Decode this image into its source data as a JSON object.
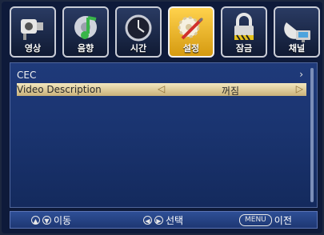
{
  "tabs": [
    {
      "label": "영상",
      "icon": "camera-icon",
      "selected": false
    },
    {
      "label": "음향",
      "icon": "music-note-icon",
      "selected": false
    },
    {
      "label": "시간",
      "icon": "clock-icon",
      "selected": false
    },
    {
      "label": "설정",
      "icon": "gear-wrench-icon",
      "selected": true
    },
    {
      "label": "잠금",
      "icon": "padlock-icon",
      "selected": false
    },
    {
      "label": "채널",
      "icon": "satellite-dish-icon",
      "selected": false
    }
  ],
  "rows": [
    {
      "label": "CEC",
      "value": ""
    },
    {
      "label": "Video Description",
      "value": "꺼짐"
    }
  ],
  "footer": {
    "move_label": "이동",
    "select_label": "선택",
    "menu_label": "MENU",
    "back_label": "이전"
  },
  "colors": {
    "accent": "#f0c040",
    "panel": "#1f3a7a",
    "highlight": "#e9dcb0"
  }
}
